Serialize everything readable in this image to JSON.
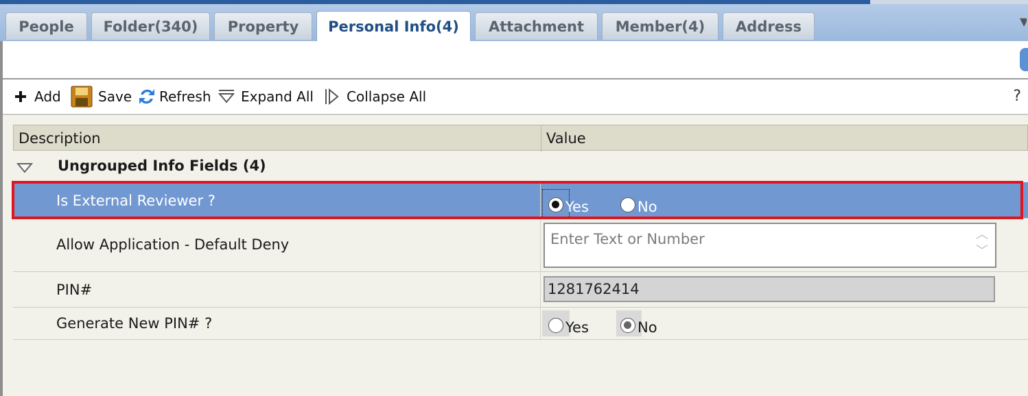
{
  "tabs": [
    {
      "label": "People"
    },
    {
      "label": "Folder(340)"
    },
    {
      "label": "Property"
    },
    {
      "label": "Personal Info(4)",
      "active": true
    },
    {
      "label": "Attachment"
    },
    {
      "label": "Member(4)"
    },
    {
      "label": "Address"
    }
  ],
  "toolbar": {
    "add_label": "Add",
    "save_label": "Save",
    "refresh_label": "Refresh",
    "expand_label": "Expand All",
    "collapse_label": "Collapse All",
    "help_label": "?"
  },
  "grid": {
    "col_description": "Description",
    "col_value": "Value",
    "group_title": "Ungrouped Info Fields (4)",
    "rows": [
      {
        "label": "Is External Reviewer ?",
        "type": "radio",
        "options": [
          "Yes",
          "No"
        ],
        "selected": "Yes",
        "highlighted": true
      },
      {
        "label": "Allow Application - Default Deny",
        "type": "textarea",
        "placeholder": "Enter Text or Number"
      },
      {
        "label": "PIN#",
        "type": "readonly",
        "value": "1281762414"
      },
      {
        "label": "Generate New PIN# ?",
        "type": "radio",
        "options": [
          "Yes",
          "No"
        ],
        "selected": "No"
      }
    ]
  },
  "colors": {
    "selected_row": "#7298d2",
    "highlight_border": "#e0161e",
    "active_tab_text": "#1f4e85"
  }
}
